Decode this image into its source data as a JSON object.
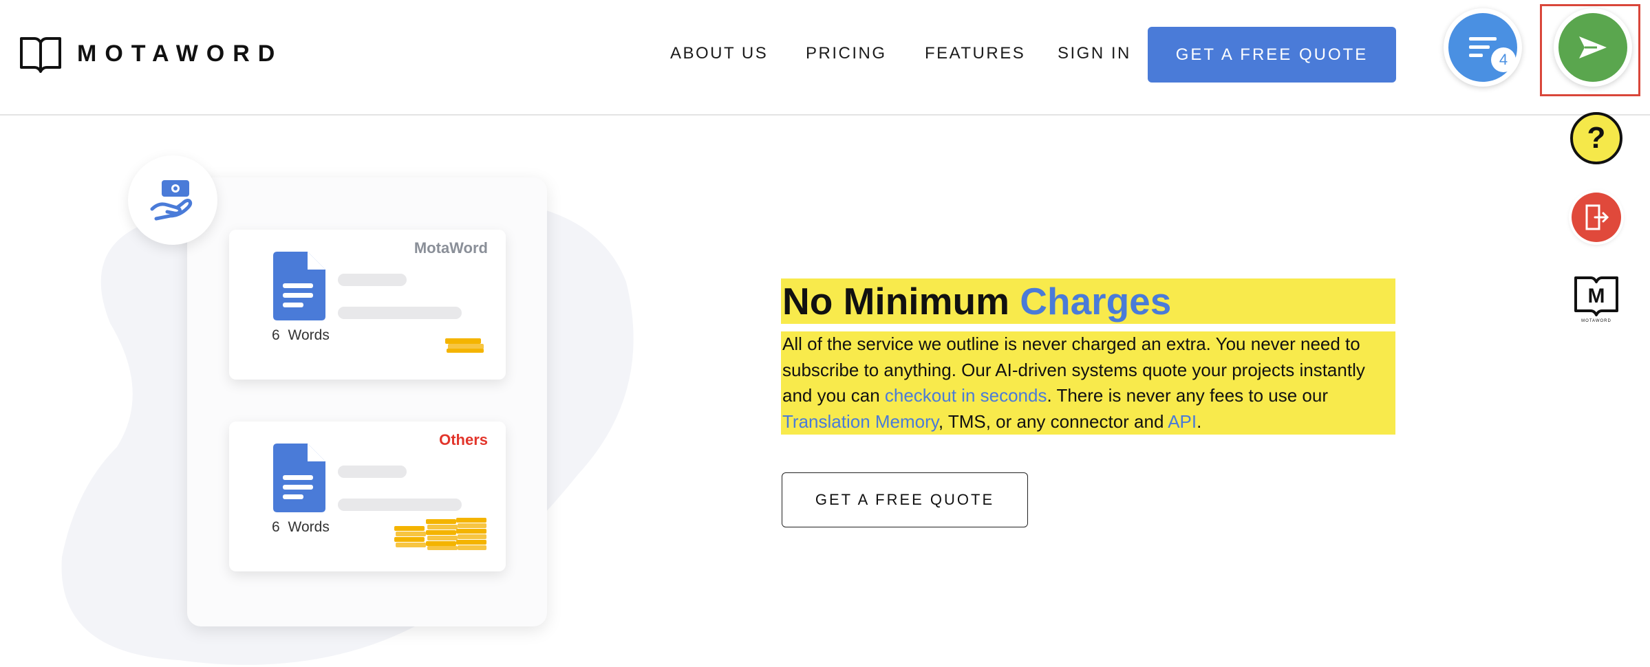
{
  "brand": {
    "name": "MOTAWORD"
  },
  "nav": {
    "items": [
      {
        "label": "ABOUT US"
      },
      {
        "label": "PRICING"
      },
      {
        "label": "FEATURES"
      },
      {
        "label": "SIGN IN"
      }
    ],
    "cta_label": "GET A FREE QUOTE"
  },
  "widgets": {
    "queue_icon": "list-icon",
    "queue_badge": "4",
    "send_icon": "send-icon",
    "help_label": "?",
    "exit_icon": "exit-icon",
    "mini_logo_text": "MOTAWORD"
  },
  "illustration": {
    "cards": [
      {
        "brand": "MotaWord",
        "word_count": "6",
        "word_label": "Words"
      },
      {
        "brand": "Others",
        "word_count": "6",
        "word_label": "Words"
      }
    ]
  },
  "hero": {
    "title_main": "No Minimum ",
    "title_accent": "Charges",
    "para_1": "All of the service we outline is never charged an extra. You never need to subscribe to anything. Our AI-driven systems quote your projects instantly and you can ",
    "link_1": "checkout in seconds",
    "para_2": ". There is never any fees to use our ",
    "link_2": "Translation Memory",
    "para_3": ", TMS, or any connector and ",
    "link_3": "API",
    "para_4": ".",
    "cta_label": "GET A FREE QUOTE"
  },
  "colors": {
    "primary_blue": "#4a7bd8",
    "highlight_yellow": "#f8ea4c",
    "send_green": "#5aa64e",
    "exit_red": "#e0493b",
    "others_red": "#e2352b"
  }
}
